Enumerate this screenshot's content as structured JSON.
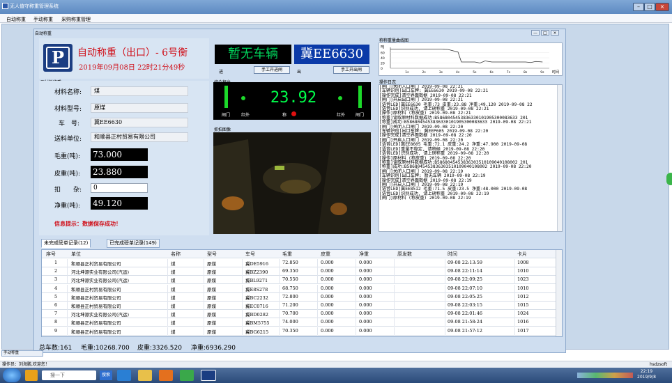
{
  "window": {
    "title": "无人值守称重管理系统"
  },
  "menu": {
    "items": [
      "自动称重",
      "手动称重",
      "采购称重管理"
    ]
  },
  "child": {
    "title": "自动称重",
    "min": "—",
    "max": "□",
    "close": "×"
  },
  "header": {
    "logo_glyph": "P",
    "title": "自动称重（出口）- 6号衡",
    "datetime": "2019年09月08日 22时21分49秒"
  },
  "entry": {
    "led_text": "暂无车辆",
    "label": "进",
    "button": "手工开进闸"
  },
  "exit": {
    "led_text": "冀EE6630",
    "label": "出",
    "button": "手工开出闸"
  },
  "sections": {
    "material_info": "原材料称重",
    "composite": "综合秤台",
    "camera": "抓拍图像",
    "weight_curve": "称称重量曲线图",
    "op_log": "操作日志"
  },
  "form": {
    "material_name_label": "材料名称:",
    "material_name": "煤",
    "material_type_label": "材料型号:",
    "material_type": "原煤",
    "plate_label": "车　号:",
    "plate": "冀EE6630",
    "supplier_label": "送料单位:",
    "supplier": "和顺县正村贸易有限公司",
    "gross_label": "毛重(吨):",
    "gross": "73.000",
    "tare_label": "皮重(吨):",
    "tare": "23.880",
    "deduct_label": "扣　　杂:",
    "deduct": "0",
    "net_label": "净重(吨):",
    "net": "49.120",
    "info": "信息提示：数据保存成功！"
  },
  "scale": {
    "weight": "23.92",
    "gate_left": "闸门",
    "ir_left": "红外",
    "center_label": "称",
    "ir_right": "红外",
    "gate_right": "闸门"
  },
  "chart_data": {
    "type": "line",
    "title": "称称重量曲线图",
    "ylabel": "吨",
    "xlabel": "时间",
    "y_ticks": [
      "60",
      "40",
      "20",
      "0"
    ],
    "x_ticks": [
      "1s",
      "2s",
      "3s",
      "4s",
      "5s",
      "6s",
      "7s",
      "8s",
      "9s"
    ],
    "ylim": [
      0,
      80
    ],
    "x": [
      0,
      0.5,
      1,
      2,
      3,
      3.4,
      4,
      4.2,
      5,
      5.3,
      5.6,
      6,
      7,
      8,
      8.3,
      8.6,
      9
    ],
    "y": [
      73,
      73,
      73,
      73,
      73,
      72,
      62,
      24,
      24,
      20,
      28,
      24,
      24,
      24,
      22,
      26,
      24
    ]
  },
  "log": [
    "[闸门]关闭入口闸门    2019-09-08 22:21",
    "[车辆识别]出口车牌: 冀EE6630   2019-09-08 22:21",
    "[操作完成]清空界面数据   2019-09-08 22:21",
    "[闸门]开启出口闸门    2019-09-08 22:21",
    "[语音LED]冀EE6630 毛重:73 皮重:23.88 净重:49.120   2019-09-08 22",
    "[语音LED]识别成功, 请上磅称重   2019-09-08 22:21",
    "[操作]原材料 (称皮重)   2019-09-08 22:21",
    "[称重]读取原材料数据成功:B5868045453836330101905300083633   201",
    "[称重]成功:B5868045453836330101905300083633   2019-09-08 22:21",
    "[闸门]关闭入口闸门    2019-09-08 22:20",
    "[车辆识别]出口车牌: 冀EEP605   2019-09-08 22:20",
    "[操作完成]清空界面数据   2019-09-08 22:20",
    "[闸门]开启入口闸门    2019-09-08 22:20",
    "[语音LED]冀EE8605 毛重:72.1 皮重:24.2 净重:47.900   2019-09-08",
    "[语音LED]重量不稳定, 请稍候   2019-09-08 22:20",
    "[语音LED]识别成功, 请上磅称重   2019-09-08 22:20",
    "[操作]原材料 (称皮重)   2019-09-08 22:20",
    "[称重]读取原材料数据成功:B5868045453836303510109040108002   201",
    "[称重]成功:B5868045453836303510109040108002   2019-09-08 22:20",
    "[闸门]关闭入口闸门    2019-09-08 22:19",
    "[车辆识别]出口车牌: 暂无车辆   2019-09-08 22:19",
    "[操作完成]清空界面数据   2019-09-08 22:19",
    "[闸门]开启入口闸门    2019-09-08 22:19",
    "[语音LED]冀EE8512 毛重:71.5 皮重:23.5 净重:48.000   2019-09-08",
    "[语音LED]识别成功, 请上磅称重   2019-09-08 22:19",
    "[闸门]原材料 (称皮重)   2019-09-08 22:19"
  ],
  "tabs": [
    "未完成磅单记录(12)",
    "已完成磅单记录(149)"
  ],
  "table": {
    "headers": [
      "序号",
      "单位",
      "名称",
      "型号",
      "车号",
      "毛重",
      "皮重",
      "净重",
      "原发数",
      "时间",
      "卡片"
    ],
    "rows": [
      [
        "1",
        "和顺县正村贸易有限公司",
        "煤",
        "原煤",
        "冀DE5916",
        "72.850",
        "0.000",
        "0.000",
        "",
        "09-08 22:13:59",
        "1008"
      ],
      [
        "2",
        "河北坤源实业有限公司(汽运)",
        "煤",
        "原煤",
        "冀BZ2390",
        "69.350",
        "0.000",
        "0.000",
        "",
        "09-08 22:11:14",
        "1010"
      ],
      [
        "3",
        "河北坤源实业有限公司(汽运)",
        "煤",
        "原煤",
        "冀BL9271",
        "70.550",
        "0.000",
        "0.000",
        "",
        "09-08 22:09:25",
        "1023"
      ],
      [
        "4",
        "和顺县正村贸易有限公司",
        "煤",
        "原煤",
        "冀E8S278",
        "68.750",
        "0.000",
        "0.000",
        "",
        "09-08 22:07:10",
        "1010"
      ],
      [
        "5",
        "和顺县正村贸易有限公司",
        "煤",
        "原煤",
        "冀BC2232",
        "72.800",
        "0.000",
        "0.000",
        "",
        "09-08 22:05:25",
        "1012"
      ],
      [
        "6",
        "和顺县正村贸易有限公司",
        "煤",
        "原煤",
        "冀EC0716",
        "71.200",
        "0.000",
        "0.000",
        "",
        "09-08 22:03:15",
        "1015"
      ],
      [
        "7",
        "河北坤源实业有限公司(汽运)",
        "煤",
        "原煤",
        "冀BD0282",
        "70.700",
        "0.000",
        "0.000",
        "",
        "09-08 22:01:46",
        "1024"
      ],
      [
        "8",
        "和顺县正村贸易有限公司",
        "煤",
        "原煤",
        "冀BM5755",
        "74.000",
        "0.000",
        "0.000",
        "",
        "09-08 21:58:24",
        "1016"
      ],
      [
        "9",
        "和顺县正村贸易有限公司",
        "煤",
        "原煤",
        "冀BG6215",
        "70.350",
        "0.000",
        "0.000",
        "",
        "09-08 21:57:12",
        "1017"
      ]
    ]
  },
  "totals": {
    "count": "总车数:161",
    "gross": "毛重:10268.700",
    "tare": "皮重:3326.520",
    "net": "净重:6936.290"
  },
  "minimized": {
    "label": "手动称重"
  },
  "status": {
    "left": "操作员：刘海鹏,欢迎您！",
    "right": "hsdzsoft"
  },
  "taskbar": {
    "search": "搜一下",
    "search_btn": "搜索",
    "time": "22:19",
    "date": "2019/9/8"
  },
  "colors": {
    "led_green": "#00d25a",
    "alert_red": "#d0101a",
    "logo_blue": "#1b3d82"
  }
}
